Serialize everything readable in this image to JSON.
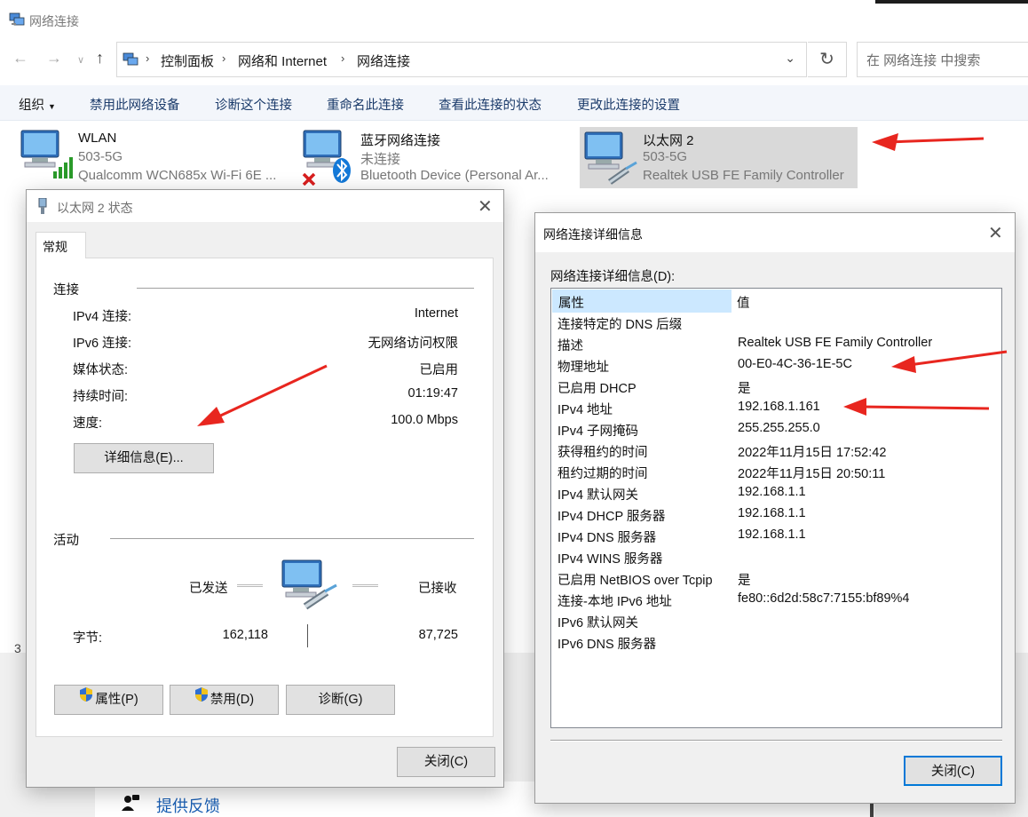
{
  "window": {
    "title": "网络连接"
  },
  "address": {
    "crumbs": [
      "控制面板",
      "网络和 Internet",
      "网络连接"
    ]
  },
  "search": {
    "placeholder": "在 网络连接 中搜索"
  },
  "commands": {
    "organize": "组织",
    "items": [
      "禁用此网络设备",
      "诊断这个连接",
      "重命名此连接",
      "查看此连接的状态",
      "更改此连接的设置"
    ]
  },
  "connections": [
    {
      "name": "WLAN",
      "status": "503-5G",
      "device": "Qualcomm WCN685x Wi-Fi 6E ..."
    },
    {
      "name": "蓝牙网络连接",
      "status": "未连接",
      "device": "Bluetooth Device (Personal Ar..."
    },
    {
      "name": "以太网 2",
      "status": "503-5G",
      "device": "Realtek USB FE Family Controller"
    }
  ],
  "status_bar": {
    "count": "3"
  },
  "feedback": {
    "label": "提供反馈"
  },
  "status_dialog": {
    "title": "以太网 2 状态",
    "tab": "常规",
    "connection_group": "连接",
    "fields": [
      {
        "label": "IPv4 连接:",
        "value": "Internet"
      },
      {
        "label": "IPv6 连接:",
        "value": "无网络访问权限"
      },
      {
        "label": "媒体状态:",
        "value": "已启用"
      },
      {
        "label": "持续时间:",
        "value": "01:19:47"
      },
      {
        "label": "速度:",
        "value": "100.0 Mbps"
      }
    ],
    "details_button": "详细信息(E)...",
    "activity_group": "活动",
    "sent_label": "已发送",
    "received_label": "已接收",
    "bytes_label": "字节:",
    "bytes_sent": "162,118",
    "bytes_received": "87,725",
    "properties_button": "属性(P)",
    "disable_button": "禁用(D)",
    "diagnose_button": "诊断(G)",
    "close_button": "关闭(C)"
  },
  "details_dialog": {
    "title": "网络连接详细信息",
    "label": "网络连接详细信息(D):",
    "col_property": "属性",
    "col_value": "值",
    "rows": [
      {
        "property": "连接特定的 DNS 后缀",
        "value": ""
      },
      {
        "property": "描述",
        "value": "Realtek USB FE Family Controller"
      },
      {
        "property": "物理地址",
        "value": "00-E0-4C-36-1E-5C"
      },
      {
        "property": "已启用 DHCP",
        "value": "是"
      },
      {
        "property": "IPv4 地址",
        "value": "192.168.1.161"
      },
      {
        "property": "IPv4 子网掩码",
        "value": "255.255.255.0"
      },
      {
        "property": "获得租约的时间",
        "value": "2022年11月15日 17:52:42"
      },
      {
        "property": "租约过期的时间",
        "value": "2022年11月15日 20:50:11"
      },
      {
        "property": "IPv4 默认网关",
        "value": "192.168.1.1"
      },
      {
        "property": "IPv4 DHCP 服务器",
        "value": "192.168.1.1"
      },
      {
        "property": "IPv4 DNS 服务器",
        "value": "192.168.1.1"
      },
      {
        "property": "IPv4 WINS 服务器",
        "value": ""
      },
      {
        "property": "已启用 NetBIOS over Tcpip",
        "value": "是"
      },
      {
        "property": "连接-本地 IPv6 地址",
        "value": "fe80::6d2d:58c7:7155:bf89%4"
      },
      {
        "property": "IPv6 默认网关",
        "value": ""
      },
      {
        "property": "IPv6 DNS 服务器",
        "value": ""
      }
    ],
    "close_button": "关闭(C)"
  },
  "colors": {
    "annotation_arrow": "#e8261f",
    "selection": "#cce8ff",
    "link": "#1a5fb4"
  }
}
